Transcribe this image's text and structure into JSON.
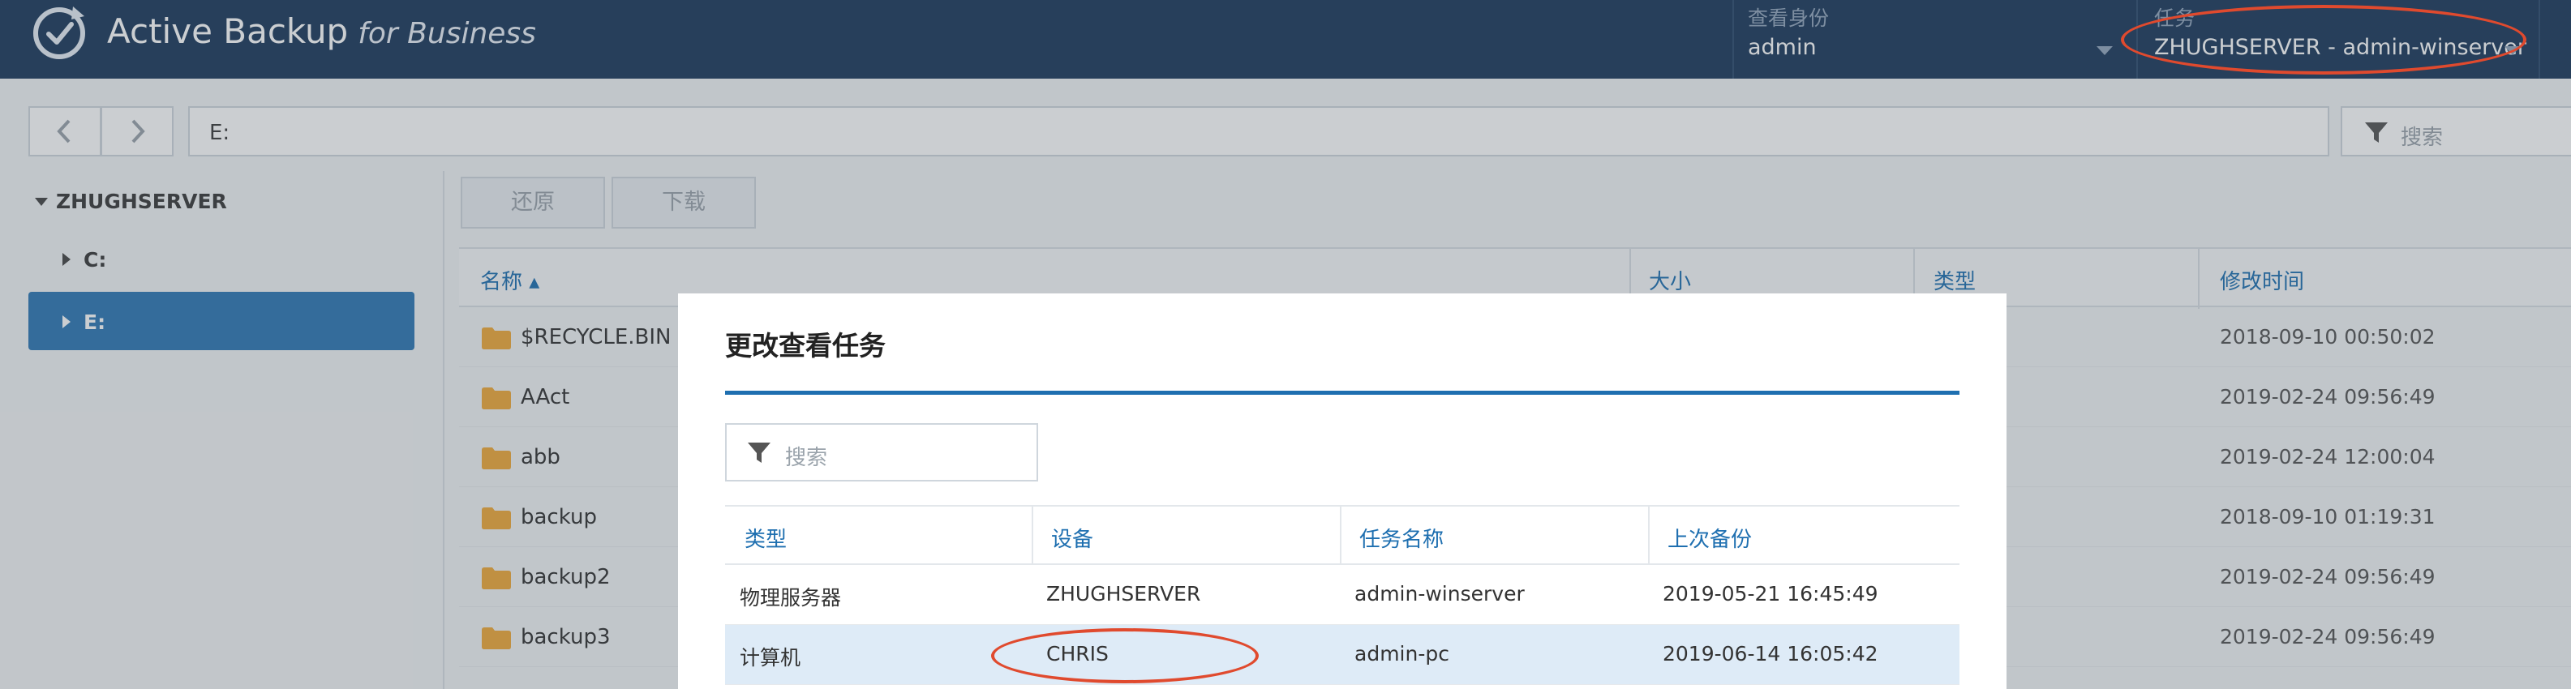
{
  "header": {
    "app_title": "Active Backup",
    "app_subtitle": "for Business",
    "view_identity": {
      "label": "查看身份",
      "value": "admin"
    },
    "task": {
      "label": "任务",
      "value": "ZHUGHSERVER - admin-winserver"
    }
  },
  "nav": {
    "path": "E:",
    "search_placeholder": "搜索"
  },
  "sidebar": {
    "items": [
      {
        "label": "ZHUGHSERVER"
      },
      {
        "label": "C:"
      },
      {
        "label": "E:"
      }
    ]
  },
  "toolbar": {
    "restore_label": "还原",
    "download_label": "下载"
  },
  "file_table": {
    "columns": [
      "名称 ▴",
      "大小",
      "类型",
      "修改时间"
    ],
    "rows": [
      {
        "name": "$RECYCLE.BIN",
        "modified": "2018-09-10 00:50:02"
      },
      {
        "name": "AAct",
        "modified": "2019-02-24 09:56:49"
      },
      {
        "name": "abb",
        "modified": "2019-02-24 12:00:04"
      },
      {
        "name": "backup",
        "modified": "2018-09-10 01:19:31"
      },
      {
        "name": "backup2",
        "modified": "2019-02-24 09:56:49"
      },
      {
        "name": "backup3",
        "modified": "2019-02-24 09:56:49"
      }
    ]
  },
  "modal": {
    "title": "更改查看任务",
    "search_placeholder": "搜索",
    "columns": [
      "类型",
      "设备",
      "任务名称",
      "上次备份"
    ],
    "rows": [
      {
        "type": "物理服务器",
        "device": "ZHUGHSERVER",
        "task": "admin-winserver",
        "last_backup": "2019-05-21 16:45:49"
      },
      {
        "type": "计算机",
        "device": "CHRIS",
        "task": "admin-pc",
        "last_backup": "2019-06-14 16:05:42"
      }
    ]
  },
  "colors": {
    "header_bg": "#1c3a5c",
    "accent": "#1e6fb0",
    "selected_tree": "#2f78b5",
    "annotation_red": "#e04a2e",
    "folder": "#f0a93a"
  },
  "icons": [
    "app-logo-icon",
    "back-arrow-icon",
    "forward-arrow-icon",
    "filter-icon",
    "folder-icon",
    "caret-down-icon",
    "tree-expand-icon",
    "tree-collapse-icon",
    "sort-asc-icon"
  ]
}
